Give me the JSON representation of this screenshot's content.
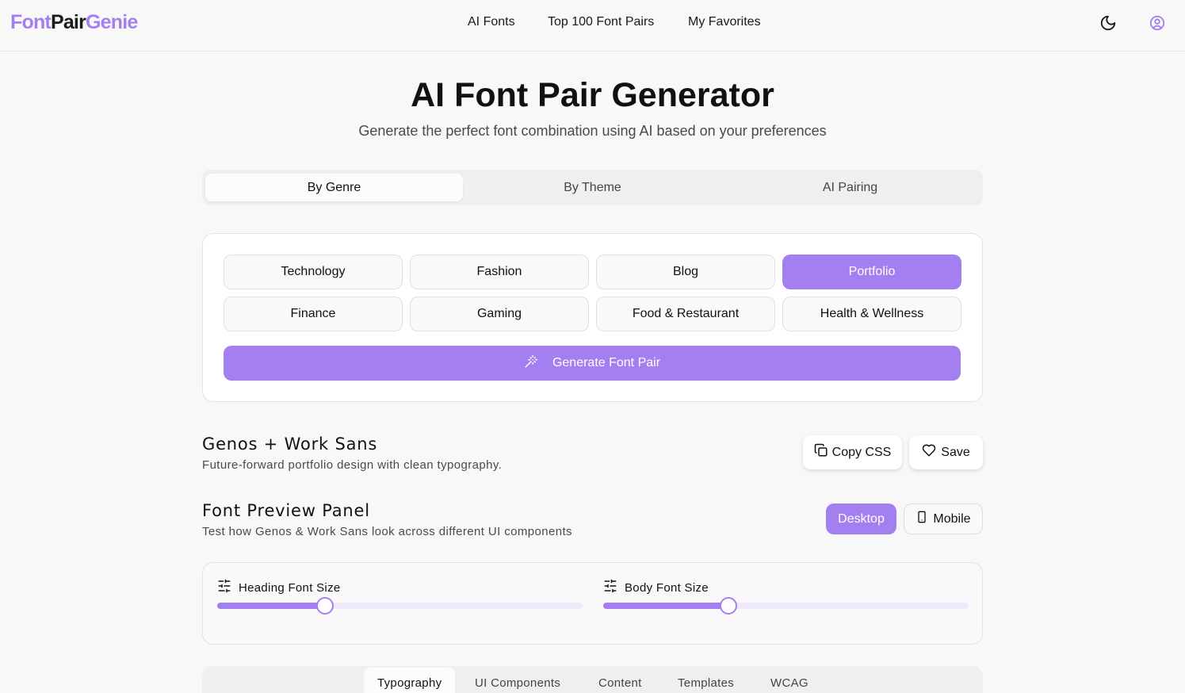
{
  "brand": {
    "part1": "Font",
    "part2": "Pair",
    "part3": "Genie",
    "accent_color": "#a47ff0"
  },
  "nav": {
    "items": [
      "AI Fonts",
      "Top 100 Font Pairs",
      "My Favorites"
    ],
    "icons": [
      "moon-icon",
      "user-circle-icon"
    ]
  },
  "hero": {
    "title": "AI Font Pair Generator",
    "subtitle": "Generate the perfect font combination using AI based on your preferences"
  },
  "mode_tabs": {
    "items": [
      "By Genre",
      "By Theme",
      "AI Pairing"
    ],
    "active": "By Genre"
  },
  "genres": {
    "items": [
      "Technology",
      "Fashion",
      "Blog",
      "Portfolio",
      "Finance",
      "Gaming",
      "Food & Restaurant",
      "Health & Wellness"
    ],
    "selected": "Portfolio"
  },
  "generate_label": "Generate Font Pair",
  "result": {
    "pair_name": "Genos + Work Sans",
    "description": "Future-forward portfolio design with clean typography.",
    "copy_label": "Copy CSS",
    "save_label": "Save"
  },
  "preview_panel": {
    "title": "Font Preview Panel",
    "description": "Test how Genos & Work Sans look across different UI components",
    "desktop_label": "Desktop",
    "mobile_label": "Mobile",
    "active_view": "Desktop"
  },
  "sliders": {
    "heading_label": "Heading Font Size",
    "heading_value_fraction": 0.295,
    "body_label": "Body Font Size",
    "body_value_fraction": 0.342
  },
  "preview_tabs": {
    "items": [
      "Typography",
      "UI Components",
      "Content",
      "Templates",
      "WCAG"
    ],
    "active": "Typography"
  }
}
